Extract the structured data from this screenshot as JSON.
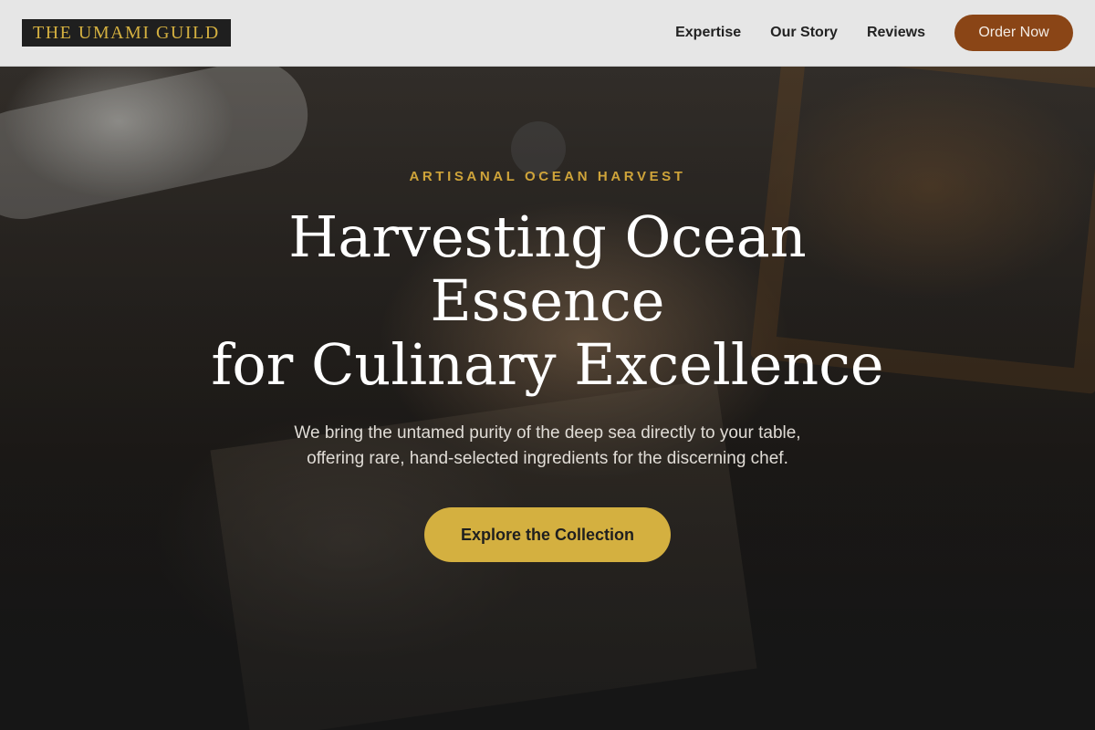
{
  "header": {
    "logo_text": "THE UMAMI GUILD",
    "nav": [
      {
        "label": "Expertise"
      },
      {
        "label": "Our Story"
      },
      {
        "label": "Reviews"
      }
    ],
    "order_button": "Order Now"
  },
  "hero": {
    "eyebrow": "ARTISANAL OCEAN HARVEST",
    "headline_lines": [
      "Harvesting Ocean",
      "Essence",
      "for Culinary Excellence"
    ],
    "subtext_lines": [
      "We bring the untamed purity of the deep sea directly to your table,",
      "offering rare, hand-selected ingredients for the discerning chef."
    ],
    "cta_label": "Explore the Collection",
    "background_image": "artisan-hands-carving-wood-photo"
  },
  "colors": {
    "accent_gold": "#d4b040",
    "order_button_brown": "#8a4516",
    "header_bg": "#e6e6e6",
    "logo_bg": "#1f1f1f"
  }
}
